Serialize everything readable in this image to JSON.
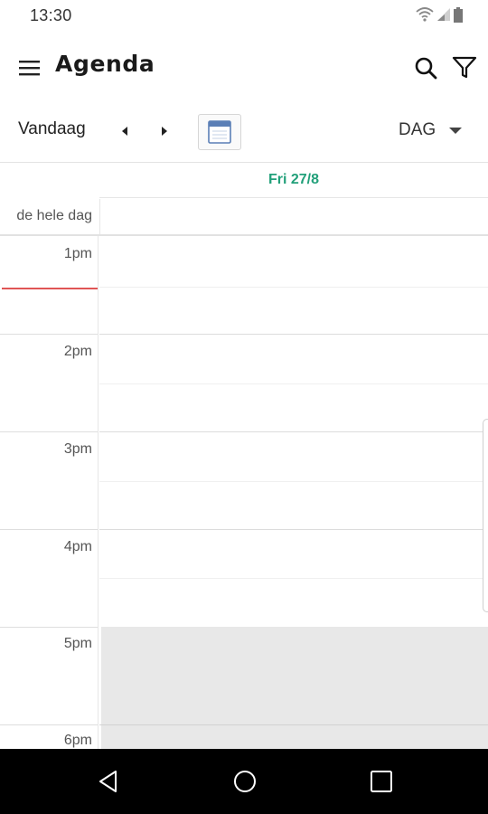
{
  "status_bar": {
    "time": "13:30",
    "icons": [
      "wifi-icon",
      "signal-icon",
      "battery-icon"
    ]
  },
  "app_bar": {
    "title": "Agenda",
    "icons": [
      "menu-icon",
      "search-icon",
      "filter-icon"
    ]
  },
  "toolbar": {
    "today_label": "Vandaag",
    "view_selected": "DAG",
    "icons": [
      "prev-icon",
      "next-icon",
      "calendar-icon",
      "caret-down-icon"
    ]
  },
  "calendar": {
    "day_header": "Fri 27/8",
    "allday_label": "de hele dag",
    "hours": [
      "1pm",
      "2pm",
      "3pm",
      "4pm",
      "5pm",
      "6pm"
    ]
  },
  "colors": {
    "accent": "#22a07a",
    "now_indicator": "#e05555",
    "offhours": "#e8e8e8"
  }
}
